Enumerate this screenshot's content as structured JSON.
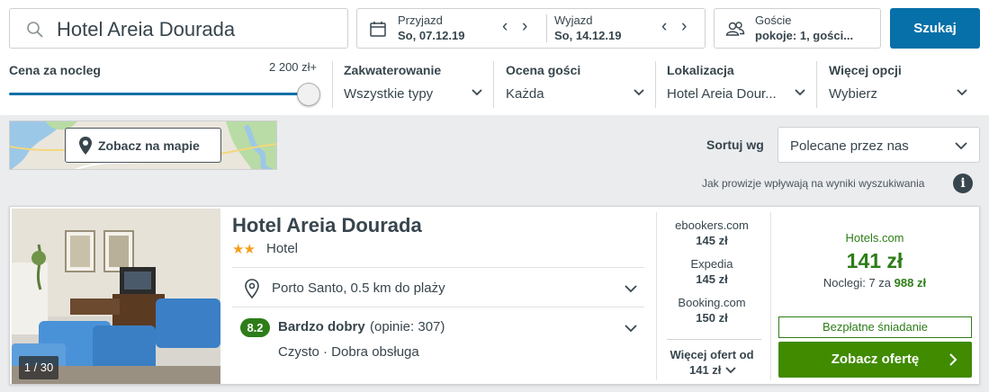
{
  "search": {
    "destination": "Hotel Areia Dourada"
  },
  "dates": {
    "checkin_label": "Przyjazd",
    "checkin_value": "So, 07.12.19",
    "checkout_label": "Wyjazd",
    "checkout_value": "So, 14.12.19",
    "prev_arrow": "‹",
    "next_arrow": "›"
  },
  "guests": {
    "label": "Goście",
    "value": "pokoje: 1, gości..."
  },
  "search_button": "Szukaj",
  "filters": {
    "price": {
      "title": "Cena za nocleg",
      "max": "2 200 zł+",
      "level_fraction": 1.0
    },
    "accommodation": {
      "title": "Zakwaterowanie",
      "value": "Wszystkie typy"
    },
    "rating": {
      "title": "Ocena gości",
      "value": "Każda"
    },
    "location": {
      "title": "Lokalizacja",
      "value": "Hotel Areia Dour..."
    },
    "more": {
      "title": "Więcej opcji",
      "value": "Wybierz"
    }
  },
  "map_button": "Zobacz na mapie",
  "sort": {
    "label": "Sortuj wg",
    "value": "Polecane przez nas"
  },
  "commission_note": "Jak prowizje wpływają na wyniki wyszukiwania",
  "hotel": {
    "name": "Hotel Areia Dourada",
    "stars": "★★",
    "type": "Hotel",
    "photo_count": "1 / 30",
    "location": "Porto Santo, 0.5 km do plaży",
    "rating_score": "8.2",
    "rating_text": "Bardzo dobry",
    "rating_count": "(opinie: 307)",
    "tags": "Czysto · Dobra obsługa",
    "offers": [
      {
        "site": "ebookers.com",
        "price": "145 zł"
      },
      {
        "site": "Expedia",
        "price": "145 zł"
      },
      {
        "site": "Booking.com",
        "price": "150 zł"
      }
    ],
    "more_offers_label": "Więcej ofert od",
    "more_offers_price": "141 zł",
    "best": {
      "site": "Hotels.com",
      "price": "141 zł",
      "nights_prefix": "Noclegi: 7 za",
      "nights_total": "988 zł",
      "breakfast": "Bezpłatne śniadanie",
      "cta": "Zobacz ofertę"
    }
  },
  "colors": {
    "accent": "#0770a8",
    "green": "#408b00",
    "rating_green": "#2d7d18",
    "star": "#f2a01c"
  }
}
